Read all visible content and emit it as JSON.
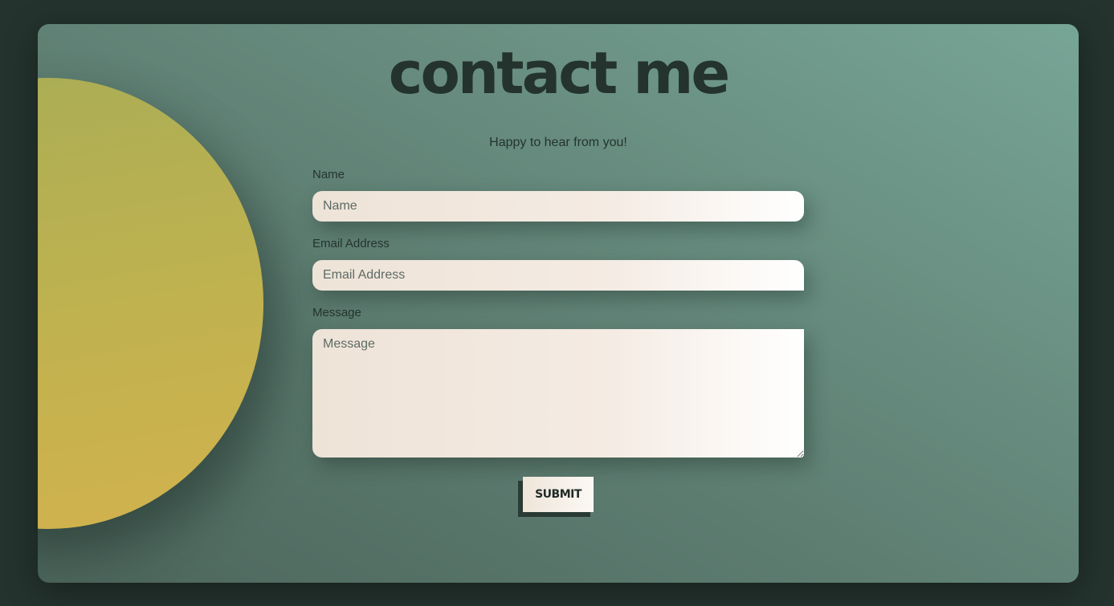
{
  "page": {
    "title": "contact me",
    "subtitle": "Happy to hear from you!"
  },
  "form": {
    "name": {
      "label": "Name",
      "placeholder": "Name",
      "value": ""
    },
    "email": {
      "label": "Email Address",
      "placeholder": "Email Address",
      "value": ""
    },
    "message": {
      "label": "Message",
      "placeholder": "Message",
      "value": ""
    },
    "submit_label": "SUBMIT"
  },
  "colors": {
    "page_background": "#24332e",
    "card_gradient_dark": "#4c655b",
    "card_gradient_light": "#77a596",
    "sun_yellow": "#c0b24f",
    "text_dark": "#24332e",
    "field_background": "#f4ebe3"
  }
}
